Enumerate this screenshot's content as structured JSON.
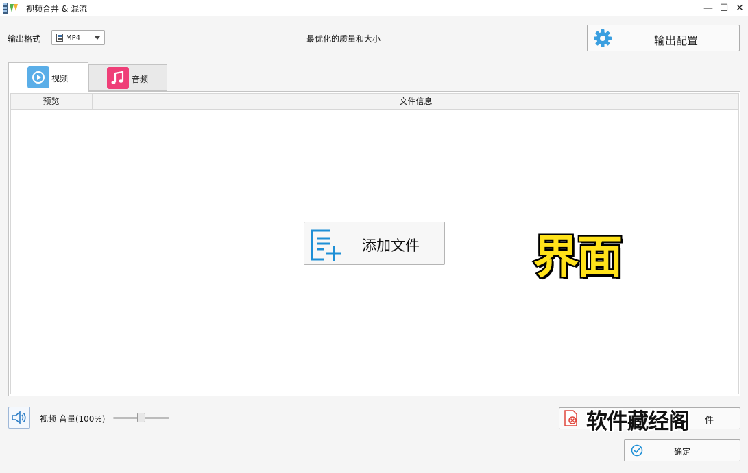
{
  "window": {
    "title": "视频合并 & 混流",
    "minimize": "—",
    "maximize": "☐",
    "close": "✕"
  },
  "toolbar": {
    "format_label": "输出格式",
    "format_value": "MP4",
    "quality_text": "最优化的质量和大小",
    "export_config_label": "输出配置"
  },
  "tabs": [
    {
      "label": "视频",
      "icon": "play-circle-icon",
      "color": "#5aaee8",
      "active": true
    },
    {
      "label": "音频",
      "icon": "music-note-icon",
      "color": "#ef3f78",
      "active": false
    }
  ],
  "table": {
    "columns": [
      "预览",
      "文件信息"
    ]
  },
  "add_file_label": "添加文件",
  "overlay": {
    "headline": "界面",
    "watermark": "软件藏经阁"
  },
  "bottom": {
    "volume_label": "视频 音量(100%)",
    "volume_value": 100,
    "clear_label_visible": "件",
    "ok_label": "确定"
  },
  "colors": {
    "accent_blue": "#1e8fd6",
    "gear_blue": "#3b9fe0",
    "clear_red": "#e0473d"
  }
}
